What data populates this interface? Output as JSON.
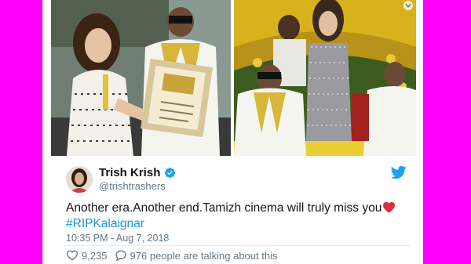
{
  "tweet": {
    "display_name": "Trish Krish",
    "handle": "@trishtrashers",
    "text": "Another era.Another end.Tamizh cinema will truly miss you",
    "hashtag": "#RIPKalaignar",
    "timestamp": "10:35 PM - Aug 7, 2018",
    "likes": "9,235",
    "talking": "976 people are talking about this"
  },
  "icons": {
    "brand": "twitter-bird-icon",
    "verified": "verified-badge-icon",
    "heart_emoji": "red-heart-emoji",
    "like": "heart-outline-icon",
    "reply": "speech-bubble-icon",
    "menu": "chevron-down-icon"
  },
  "colors": {
    "page_background": "#ff00ff",
    "twitter_blue": "#1da1f2",
    "link": "#1b95e0",
    "muted_text": "#657786",
    "heart": "#e0245e"
  }
}
